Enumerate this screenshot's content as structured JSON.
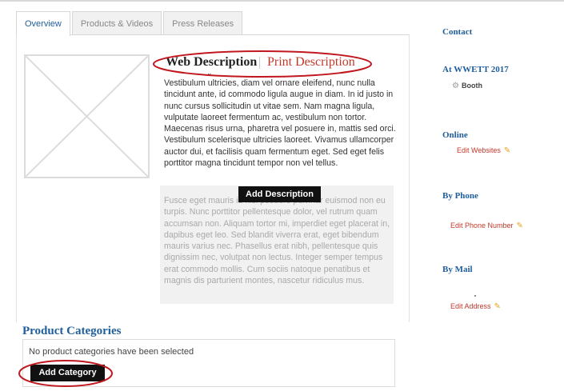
{
  "tabs": [
    "Overview",
    "Products & Videos",
    "Press Releases"
  ],
  "active_tab": "Overview",
  "description": {
    "web_label": "Web Description",
    "print_label": "Print Description",
    "web_text": "Vestibulum ultricies, diam vel ornare eleifend, nunc nulla tincidunt ante, id commodo ligula augue in diam. In id justo in nunc cursus sollicitudin ut vitae sem. Nam magna ligula, vulputate laoreet fermentum ac, vestibulum non tortor. Maecenas risus urna, pharetra vel posuere in, mattis sed orci. Vestibulum scelerisque ultricies laoreet. Vivamus ullamcorper auctor dui, et facilisis quam fermentum eget. Sed eget felis porttitor magna tincidunt tempor non vel tellus.",
    "print_text": "Fusce eget mauris id nisi posuere pulvinar euismod non eu turpis. Nunc porttitor pellentesque dolor, vel rutrum quam accumsan non. Aliquam tortor mi, imperdiet eget placerat in, dapibus eget leo. Sed blandit viverra erat, eget bibendum mauris varius nec. Phasellus erat nibh, pellentesque quis dignissim nec, volutpat non lectus. Integer semper tempus erat commodo mollis. Cum sociis natoque penatibus et magnis dis parturient montes, nascetur ridiculus mus.",
    "add_button": "Add Description"
  },
  "categories": {
    "title": "Product Categories",
    "empty_text": "No product categories have been selected",
    "add_button": "Add Category"
  },
  "sidebar": {
    "contact": "Contact",
    "event_heading": "At WWETT 2017",
    "booth_label": "Booth",
    "online_heading": "Online",
    "edit_websites": "Edit Websites",
    "phone_heading": "By Phone",
    "edit_phone": "Edit Phone Number",
    "mail_heading": "By Mail",
    "edit_address": "Edit Address"
  },
  "colors": {
    "accent_blue": "#1f5e9c",
    "link_red": "#c0392b",
    "annotation_red": "#c0181e"
  }
}
